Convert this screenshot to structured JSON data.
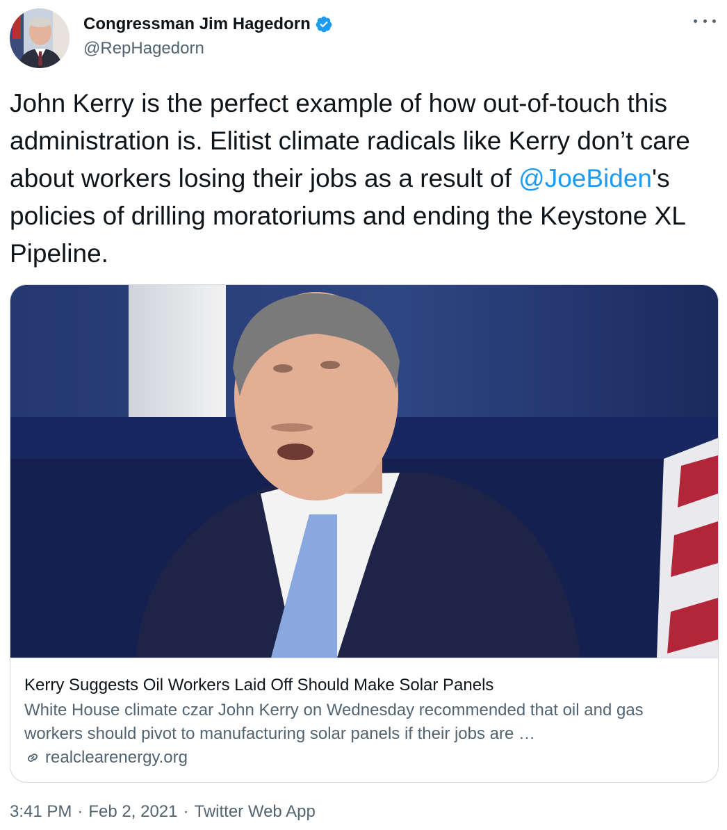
{
  "author": {
    "display_name": "Congressman Jim Hagedorn",
    "handle": "@RepHagedorn",
    "verified": true,
    "avatar_icon": "profile-photo"
  },
  "tweet": {
    "text_part1": "John Kerry is the perfect example of how out-of-touch this administration is. Elitist climate radicals like Kerry don’t care about workers losing their jobs as a result of ",
    "mention": "@JoeBiden",
    "text_part2": "'s policies of drilling moratoriums and ending the Keystone XL Pipeline."
  },
  "link_card": {
    "title": "Kerry Suggests Oil Workers Laid Off Should Make Solar Panels",
    "description": "White House climate czar John Kerry on Wednesday recommended that oil and gas workers should pivot to manufacturing solar panels if their jobs are …",
    "domain": "realclearenergy.org",
    "image_icon": "news-photo"
  },
  "meta": {
    "time": "3:41 PM",
    "separator": "·",
    "date": "Feb 2, 2021",
    "source": "Twitter Web App"
  },
  "colors": {
    "link_blue": "#1d9bf0",
    "secondary_text": "#536471",
    "border": "#cfd9de"
  }
}
